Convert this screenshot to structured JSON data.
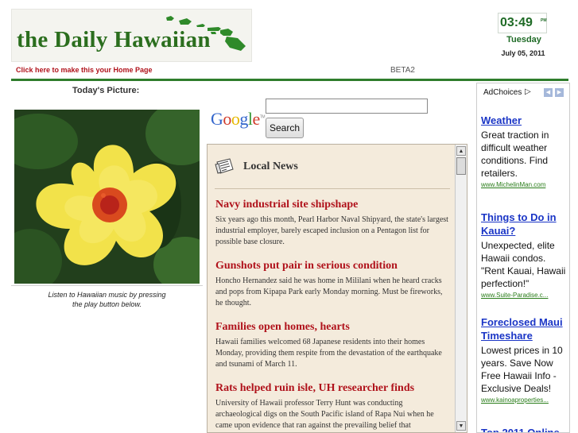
{
  "header": {
    "logo_text": "the Daily Hawaiian",
    "home_link": "Click here to make this your Home Page",
    "beta_label": "BETA2"
  },
  "clock": {
    "time": "03:49",
    "ampm": "PM",
    "day": "Tuesday",
    "date": "July 05, 2011"
  },
  "picture_section": {
    "title": "Today's Picture:",
    "caption_line1": "Listen to Hawaiian music by pressing",
    "caption_line2": "the play button below."
  },
  "search": {
    "logo_letters": [
      "G",
      "o",
      "o",
      "g",
      "l",
      "e"
    ],
    "logo_tm": "TM",
    "button_label": "Search",
    "value": ""
  },
  "news": {
    "title": "Local News",
    "stories": [
      {
        "headline": "Navy industrial site shipshape",
        "summary": "Six years ago this month, Pearl Harbor Naval Shipyard, the state's largest industrial employer, barely escaped inclusion on a Pentagon list for possible base closure."
      },
      {
        "headline": "Gunshots put pair in serious condition",
        "summary": "Honcho Hernandez said he was home in Mililani when he heard cracks and pops from Kipapa Park early Monday morning. Must be fireworks, he thought."
      },
      {
        "headline": "Families open homes, hearts",
        "summary": "Hawaii families welcomed 68 Japanese residents into their homes Monday, providing them respite from the devastation of the earthquake and tsunami of March 11."
      },
      {
        "headline": "Rats helped ruin isle, UH researcher finds",
        "summary": "University of Hawaii professor Terry Hunt was conducting archaeological digs on the South Pacific island of Rapa Nui when he came upon evidence that ran against the prevailing belief that"
      }
    ]
  },
  "ads": {
    "adchoices_label": "AdChoices",
    "items": [
      {
        "title": "Weather",
        "body": "Great traction in difficult weather conditions. Find retailers.",
        "url": "www.MichelinMan.com"
      },
      {
        "title": "Things to Do in Kauai?",
        "body": "Unexpected, elite Hawaii condos. \"Rent Kauai, Hawaii perfection!\"",
        "url": "www.Suite-Paradise.c..."
      },
      {
        "title": "Foreclosed Maui Timeshare",
        "body": "Lowest prices in 10 years. Save Now Free Hawaii Info - Exclusive Deals!",
        "url": "www.kainoaproperties..."
      },
      {
        "title": "Top 2011 Online",
        "body": "",
        "url": ""
      }
    ]
  },
  "colors": {
    "accent_green": "#2f7d2c",
    "headline_red": "#b0121b",
    "ad_link_blue": "#1a35c6",
    "news_background": "#f4ebdc"
  }
}
